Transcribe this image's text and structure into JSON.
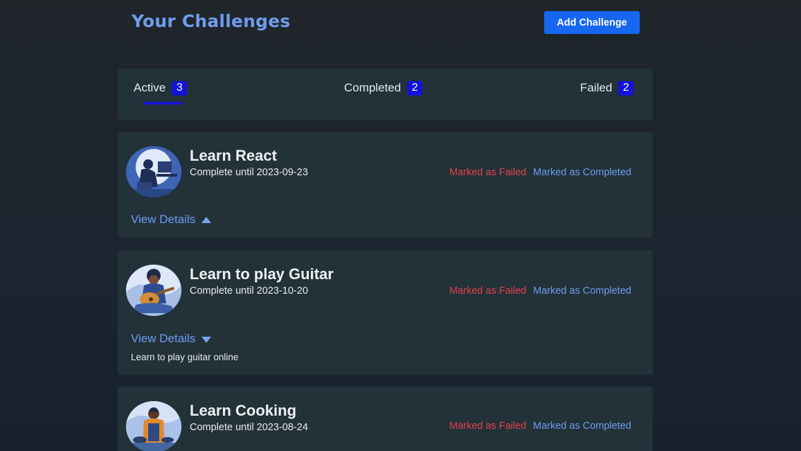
{
  "header": {
    "title": "Your Challenges",
    "add_button_label": "Add Challenge"
  },
  "tabs": [
    {
      "label": "Active",
      "count": "3",
      "selected": true
    },
    {
      "label": "Completed",
      "count": "2",
      "selected": false
    },
    {
      "label": "Failed",
      "count": "2",
      "selected": false
    }
  ],
  "colors": {
    "accent": "#1766f0",
    "title": "#6f9cec",
    "badge": "#1212d8",
    "failed": "#e3434a",
    "completed": "#6e9ef0",
    "card_bg": "#233139"
  },
  "challenges": [
    {
      "title": "Learn React",
      "subtitle": "Complete until 2023-09-23",
      "failed_label": "Marked as Failed",
      "completed_label": "Marked as Completed",
      "details_label": "View Details",
      "details_icon": "caret-up-icon",
      "avatar": "person-at-computer-illustration"
    },
    {
      "title": "Learn to play Guitar",
      "subtitle": "Complete until 2023-10-20",
      "failed_label": "Marked as Failed",
      "completed_label": "Marked as Completed",
      "details_label": "View Details",
      "details_icon": "caret-down-icon",
      "description": "Learn to play guitar online",
      "avatar": "person-playing-guitar-illustration"
    },
    {
      "title": "Learn Cooking",
      "subtitle": "Complete until 2023-08-24",
      "failed_label": "Marked as Failed",
      "completed_label": "Marked as Completed",
      "avatar": "person-cooking-illustration"
    }
  ]
}
